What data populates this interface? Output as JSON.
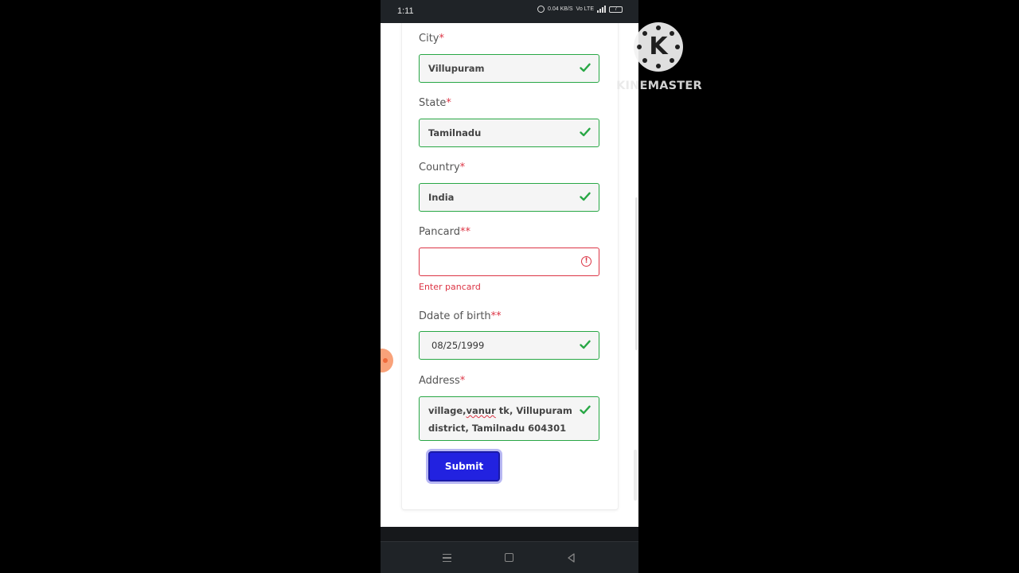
{
  "status_bar": {
    "time": "1:11",
    "net_speed": "0.04 KB/S",
    "network": "Vo LTE",
    "battery": "7"
  },
  "form": {
    "city": {
      "label": "City",
      "required_mark": "*",
      "value": "Villupuram"
    },
    "state": {
      "label": "State",
      "required_mark": "*",
      "value": "Tamilnadu"
    },
    "country": {
      "label": "Country",
      "required_mark": "*",
      "value": "India"
    },
    "pancard": {
      "label": "Pancard",
      "required_mark": "**",
      "value": "",
      "error": "Enter pancard"
    },
    "dob": {
      "label": "Ddate of birth",
      "required_mark": "**",
      "value": "08/25/1999"
    },
    "address": {
      "label": "Address",
      "required_mark": "*",
      "line1_a": "village,",
      "line1_misspelled": "vanur",
      "line1_b": " tk, Villupuram",
      "line2": "district, Tamilnadu 604301"
    },
    "submit_label": "Submit"
  },
  "watermark": {
    "text": "KINEMASTER",
    "logo_letter": "K"
  },
  "colors": {
    "valid": "#28a745",
    "invalid": "#dc3545",
    "submit": "#2222e0",
    "status_bar": "#1f2327"
  },
  "icons": {
    "valid": "check-icon",
    "invalid": "exclamation-circle-icon",
    "nav": [
      "menu-icon",
      "home-square-icon",
      "back-triangle-icon"
    ]
  }
}
